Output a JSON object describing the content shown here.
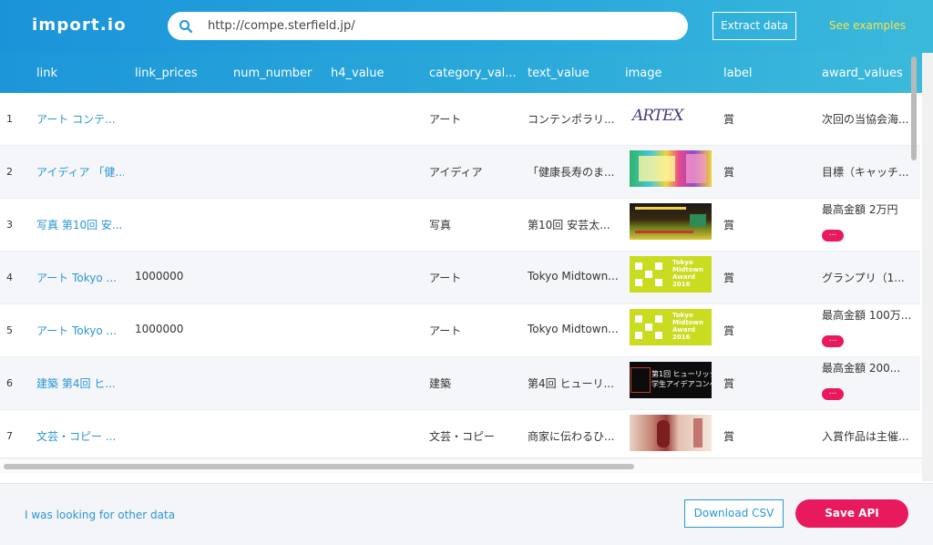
{
  "header": {
    "logo": "import.io",
    "search_value": "http://compe.sterfield.jp/",
    "extract_label": "Extract data",
    "examples_label": "See examples"
  },
  "columns": [
    "link",
    "link_prices",
    "num_number",
    "h4_value",
    "category_val...",
    "text_value",
    "image",
    "label",
    "award_values"
  ],
  "rows": [
    {
      "num": "1",
      "link": "アート コンテ...",
      "price": "",
      "category": "アート",
      "text": "コンテンポラリ...",
      "image": "artex-logo",
      "label": "賞",
      "award": "次回の当協会海...",
      "more": false
    },
    {
      "num": "2",
      "link": "アイディア 「健...",
      "price": "",
      "category": "アイディア",
      "text": "「健康長寿のま...",
      "image": "colorful-poster",
      "label": "賞",
      "award": "目標（キャッチ...",
      "more": false
    },
    {
      "num": "3",
      "link": "写真 第10回 安...",
      "price": "",
      "category": "写真",
      "text": "第10回 安芸太...",
      "image": "photo-contest-banner",
      "label": "賞",
      "award": "最高金額 2万円",
      "more": true
    },
    {
      "num": "4",
      "link": "アート Tokyo ...",
      "price": "1000000",
      "category": "アート",
      "text": "Tokyo Midtown...",
      "image": "tokyo-midtown-award",
      "label": "賞",
      "award": "グランプリ（1...",
      "more": false
    },
    {
      "num": "5",
      "link": "アート Tokyo ...",
      "price": "1000000",
      "category": "アート",
      "text": "Tokyo Midtown...",
      "image": "tokyo-midtown-award",
      "label": "賞",
      "award": "最高金額 100万...",
      "more": true
    },
    {
      "num": "6",
      "link": "建築 第4回 ヒ...",
      "price": "",
      "category": "建築",
      "text": "第4回 ヒューリ...",
      "image": "hulic-banner",
      "label": "賞",
      "award": "最高金額 200...",
      "more": true
    },
    {
      "num": "7",
      "link": "文芸・コピー ...",
      "price": "",
      "category": "文芸・コピー",
      "text": "商家に伝わるひ...",
      "image": "dolls-photo",
      "label": "賞",
      "award": "入賞作品は主催...",
      "more": false
    }
  ],
  "more_label": "...",
  "images": {
    "artex_text": "ARTEX",
    "midtown_line1": "Tokyo",
    "midtown_line2": "Midtown",
    "midtown_line3": "Award",
    "midtown_line4": "2016",
    "hulic_line1": "第1回 ヒューリック",
    "hulic_line2": "学生アイデアコンペ"
  },
  "footer": {
    "other_link": "I was looking for other data",
    "csv_label": "Download CSV",
    "api_label": "Save API"
  },
  "colors": {
    "accent_blue": "#2a96d3",
    "pink": "#e8195d",
    "examples_yellow": "#f3e44a"
  }
}
